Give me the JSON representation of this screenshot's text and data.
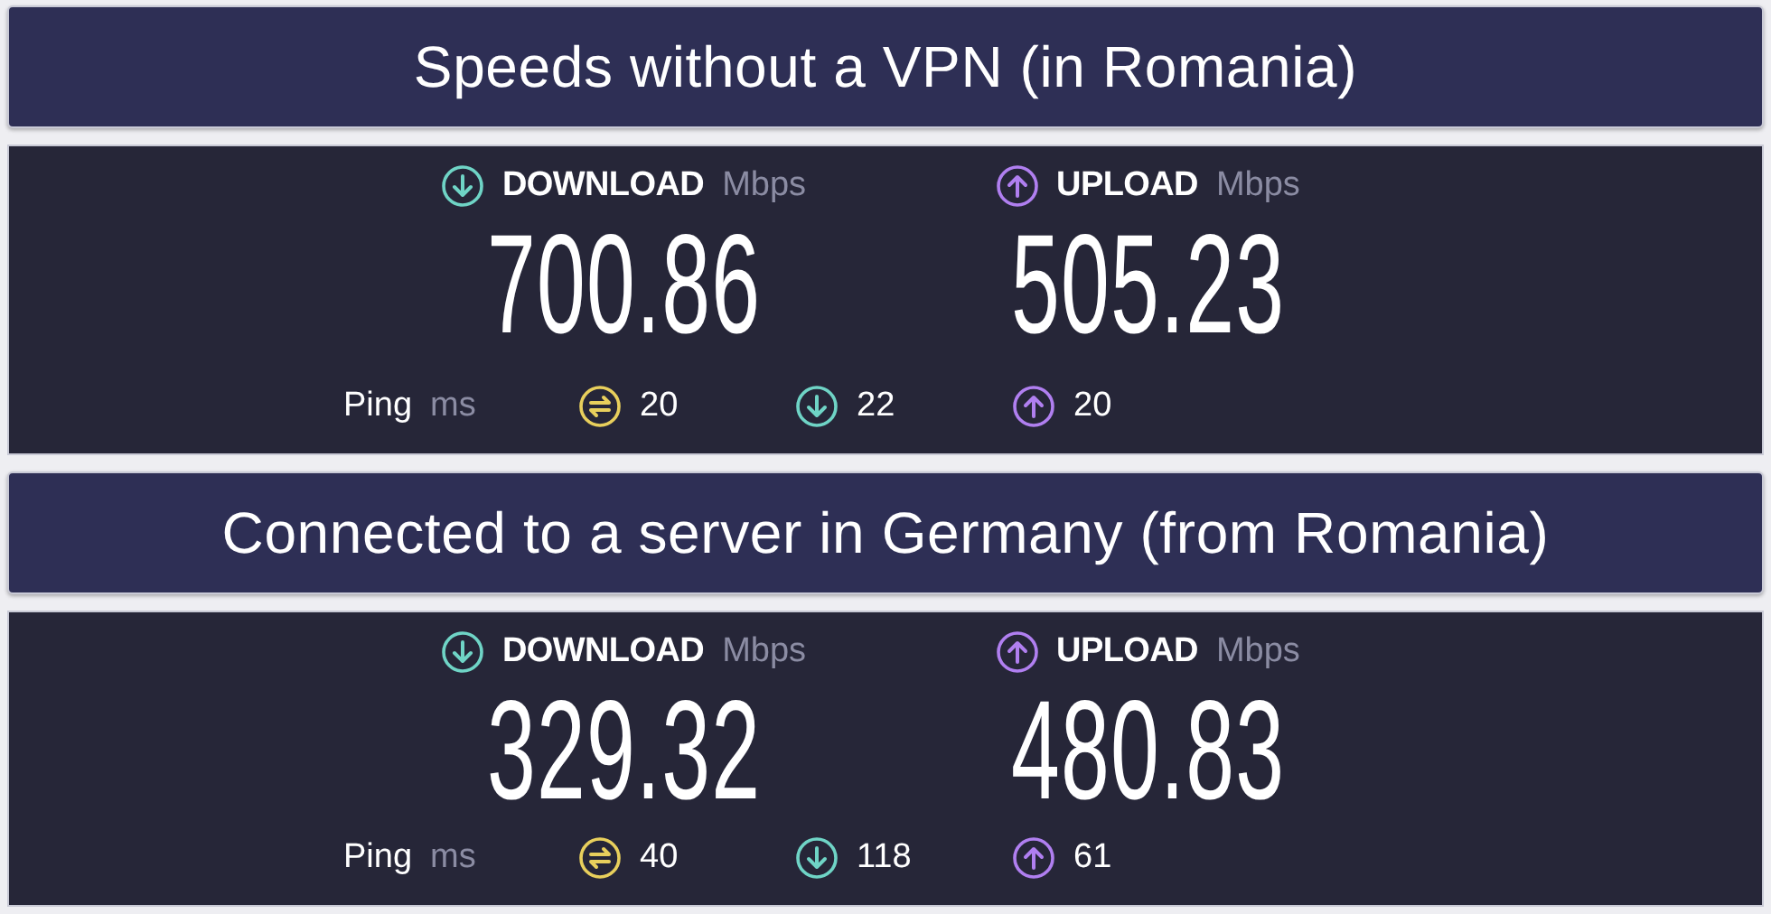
{
  "sections": [
    {
      "title": "Speeds without a VPN (in Romania)",
      "download": {
        "label": "DOWNLOAD",
        "unit": "Mbps",
        "value": "700.86"
      },
      "upload": {
        "label": "UPLOAD",
        "unit": "Mbps",
        "value": "505.23"
      },
      "ping": {
        "label": "Ping",
        "unit": "ms",
        "items": [
          {
            "kind": "idle",
            "value": "20"
          },
          {
            "kind": "download",
            "value": "22"
          },
          {
            "kind": "upload",
            "value": "20"
          }
        ]
      }
    },
    {
      "title": "Connected to a server in Germany (from Romania)",
      "download": {
        "label": "DOWNLOAD",
        "unit": "Mbps",
        "value": "329.32"
      },
      "upload": {
        "label": "UPLOAD",
        "unit": "Mbps",
        "value": "480.83"
      },
      "ping": {
        "label": "Ping",
        "unit": "ms",
        "items": [
          {
            "kind": "idle",
            "value": "40"
          },
          {
            "kind": "download",
            "value": "118"
          },
          {
            "kind": "upload",
            "value": "61"
          }
        ]
      }
    }
  ]
}
